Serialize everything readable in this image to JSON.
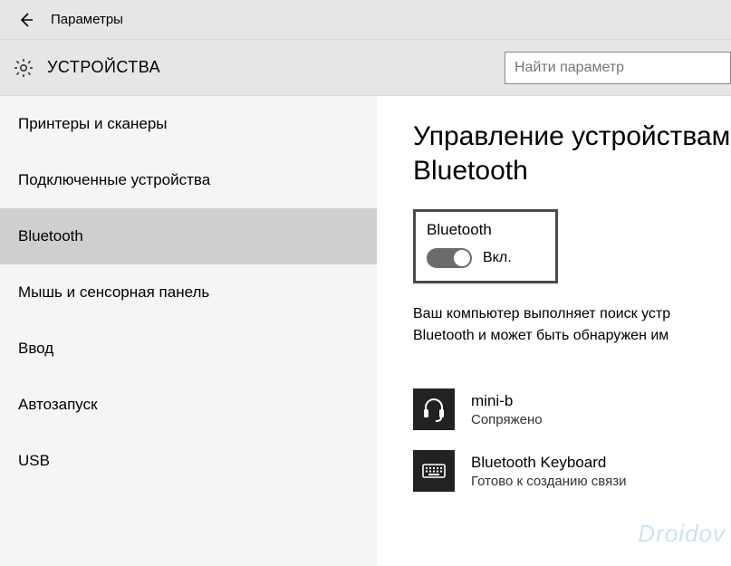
{
  "titlebar": {
    "title": "Параметры"
  },
  "header": {
    "section": "УСТРОЙСТВА",
    "search_placeholder": "Найти параметр"
  },
  "sidebar": {
    "items": [
      {
        "label": "Принтеры и сканеры"
      },
      {
        "label": "Подключенные устройства"
      },
      {
        "label": "Bluetooth"
      },
      {
        "label": "Мышь и сенсорная панель"
      },
      {
        "label": "Ввод"
      },
      {
        "label": "Автозапуск"
      },
      {
        "label": "USB"
      }
    ],
    "selected_index": 2
  },
  "content": {
    "heading": "Управление устройствам Bluetooth",
    "toggle": {
      "label": "Bluetooth",
      "state": "Вкл.",
      "on": true
    },
    "status_line1": "Ваш компьютер выполняет поиск устр",
    "status_line2": "Bluetooth и может быть обнаружен им",
    "devices": [
      {
        "icon": "headset-icon",
        "name": "mini-b",
        "status": "Сопряжено"
      },
      {
        "icon": "keyboard-icon",
        "name": "Bluetooth Keyboard",
        "status": "Готово к созданию связи"
      }
    ]
  },
  "watermark": "Droidov"
}
